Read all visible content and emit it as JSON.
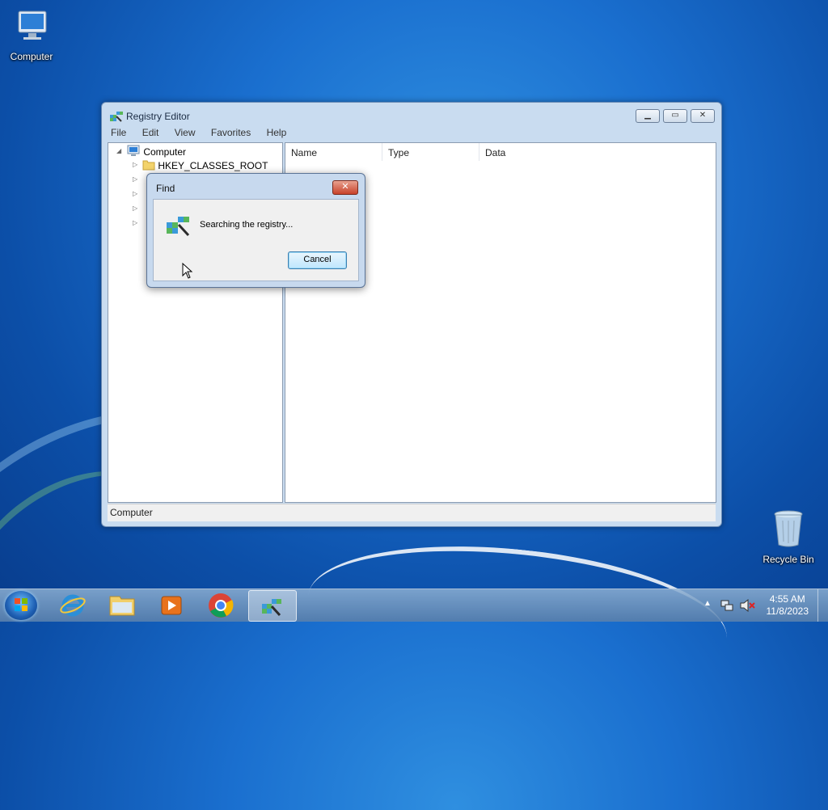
{
  "desktop": {
    "computer_label": "Computer",
    "recycle_label": "Recycle Bin"
  },
  "regedit": {
    "title": "Registry Editor",
    "menu": [
      "File",
      "Edit",
      "View",
      "Favorites",
      "Help"
    ],
    "tree": {
      "root": "Computer",
      "first_child": "HKEY_CLASSES_ROOT"
    },
    "columns": [
      "Name",
      "Type",
      "Data"
    ],
    "status": "Computer"
  },
  "find_dialog": {
    "title": "Find",
    "message": "Searching the registry...",
    "cancel_label": "Cancel",
    "close_glyph": "✕"
  },
  "taskbar": {
    "time": "4:55 AM",
    "date": "11/8/2023"
  },
  "colors": {
    "desktop": "#1a6fcf",
    "window_frame": "#c9dcf0",
    "close_red": "#c8422a"
  }
}
